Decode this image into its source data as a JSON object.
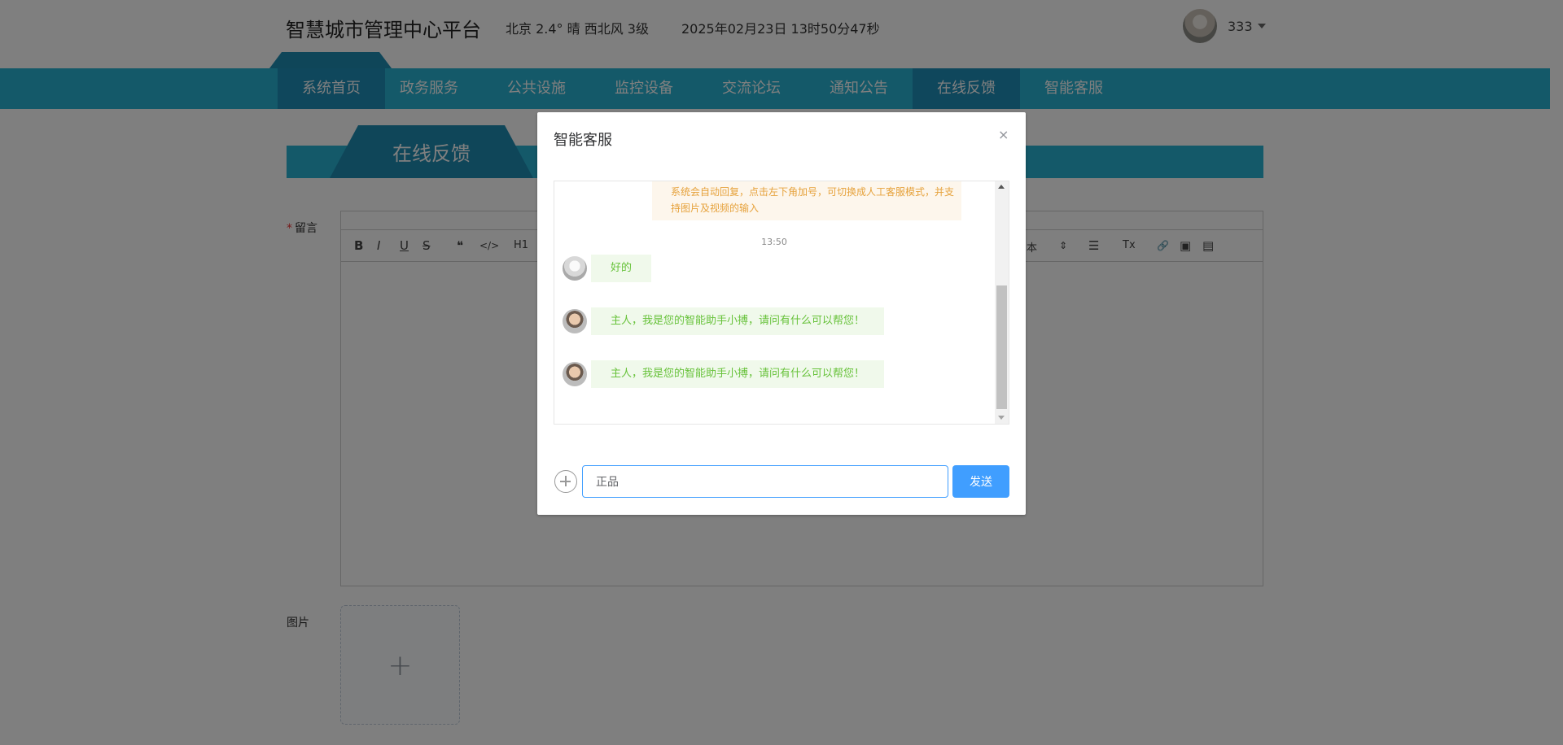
{
  "header": {
    "title": "智慧城市管理中心平台",
    "weather": "北京  2.4°  晴  西北风  3级",
    "datetime": "2025年02月23日 13时50分47秒",
    "username": "333"
  },
  "nav": {
    "items": [
      "系统首页",
      "政务服务",
      "公共设施",
      "监控设备",
      "交流论坛",
      "通知公告",
      "在线反馈",
      "智能客服"
    ],
    "active": "在线反馈",
    "color": "#29b3d2",
    "active_color": "#1e8fb8"
  },
  "page": {
    "section_title": "在线反馈",
    "message_label": "留言",
    "required_mark": "*",
    "image_label": "图片",
    "upload_plus": "+",
    "editor_toolbar": {
      "bold": "B",
      "italic": "I",
      "underline": "U",
      "strike": "S",
      "quote": "❝",
      "code": "</>",
      "h1": "H1",
      "font": "本",
      "font_select": "⇕",
      "align": "☰",
      "clean": "Tx",
      "link": "🔗",
      "image": "▣",
      "video": "▤"
    }
  },
  "dialog": {
    "title": "智能客服",
    "close": "×",
    "system_notice": "系统会自动回复，点击左下角加号，可切换成人工客服模式，并支持图片及视频的输入",
    "timestamp": "13:50",
    "messages": [
      {
        "from": "user",
        "text": "好的"
      },
      {
        "from": "bot",
        "text": "主人，我是您的智能助手小搏，请问有什么可以帮您！"
      },
      {
        "from": "bot",
        "text": "主人，我是您的智能助手小搏，请问有什么可以帮您！"
      }
    ],
    "input_value": "正品",
    "send_label": "发送",
    "accent": "#409eff",
    "bubble_color": "#f0f9eb",
    "bubble_text_color": "#67c23a",
    "notice_color": "#e6a23c"
  }
}
